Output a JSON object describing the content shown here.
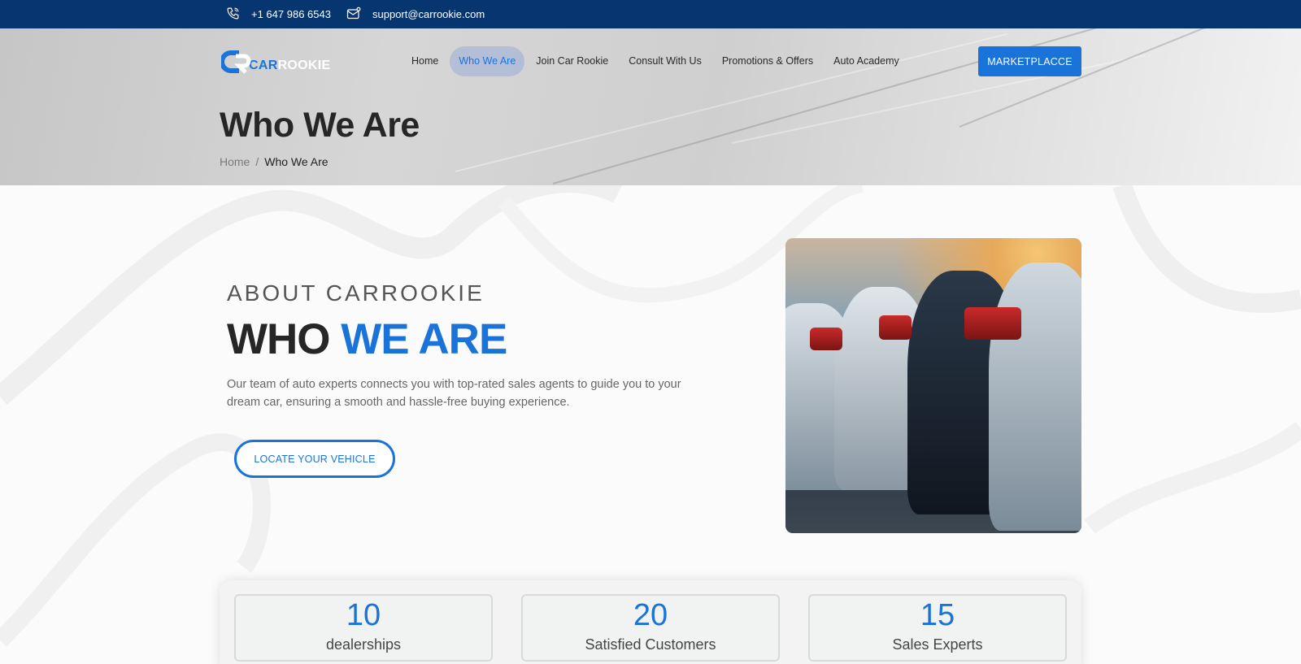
{
  "topbar": {
    "phone": "+1 647 986 6543",
    "email": "support@carrookie.com"
  },
  "logo": {
    "part1": "CAR",
    "part2": "ROOKIE"
  },
  "nav": {
    "items": [
      {
        "label": "Home"
      },
      {
        "label": "Who We Are",
        "active": true
      },
      {
        "label": "Join Car Rookie"
      },
      {
        "label": "Consult With Us"
      },
      {
        "label": "Promotions & Offers"
      },
      {
        "label": "Auto Academy"
      }
    ],
    "marketplace_label": "MARKETPLACCE"
  },
  "hero": {
    "title": "Who We Are",
    "breadcrumb": {
      "home": "Home",
      "separator": "/",
      "current": "Who We Are"
    }
  },
  "about": {
    "eyebrow": "ABOUT CARROOKIE",
    "headline_dark": "WHO",
    "headline_blue": "WE ARE",
    "description": "Our team of auto experts connects you with top-rated sales agents to guide you to your dream car, ensuring a smooth and hassle-free buying experience.",
    "cta_label": "LOCATE YOUR VEHICLE"
  },
  "stats": [
    {
      "number": "10",
      "label": "dealerships"
    },
    {
      "number": "20",
      "label": "Satisfied Customers"
    },
    {
      "number": "15",
      "label": "Sales Experts"
    }
  ],
  "colors": {
    "brand_blue": "#1a73d9",
    "topbar_navy": "#07356f"
  }
}
